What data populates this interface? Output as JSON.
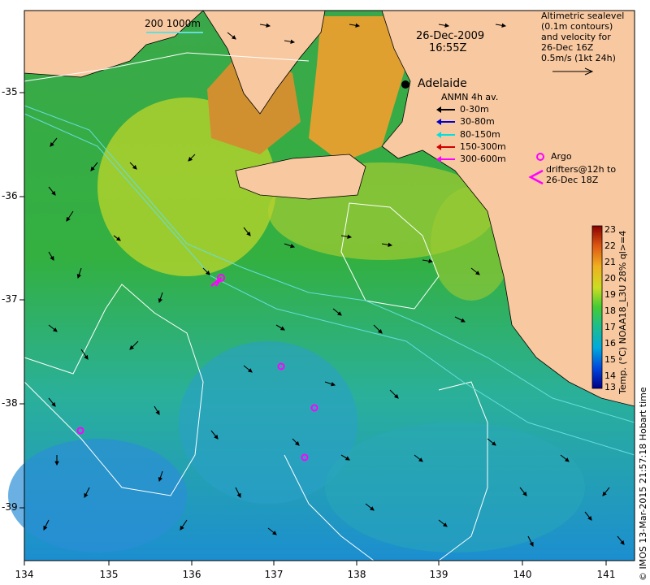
{
  "date_line": "26-Dec-2009",
  "time_line": "16:55Z",
  "scale_label": "200  1000m",
  "city_label": "Adelaide",
  "altimetry": {
    "lines": [
      "Altimetric sealevel",
      "(0.1m contours)",
      "and velocity for",
      "26-Dec 16Z",
      "0.5m/s (1kt 24h)"
    ]
  },
  "anmn": {
    "title": "ANMN 4h av.",
    "items": [
      {
        "label": "0-30m",
        "color": "#000000"
      },
      {
        "label": "30-80m",
        "color": "#0000cc"
      },
      {
        "label": "80-150m",
        "color": "#00e0e0"
      },
      {
        "label": "150-300m",
        "color": "#d00000"
      },
      {
        "label": "300-600m",
        "color": "#ff00ff"
      }
    ]
  },
  "argo": {
    "line1": "Argo",
    "line2": "drifters@12h to",
    "line3": "26-Dec 18Z",
    "color": "#ff00ff"
  },
  "colorbar": {
    "title": "Temp. (°C) NOAA18_L3U 28% ql>=4",
    "ticks": [
      "23",
      "22",
      "21",
      "20",
      "19",
      "18",
      "17",
      "16",
      "15",
      "14",
      "13"
    ]
  },
  "credit": "© IMOS 13-Mar-2015 21:57:18 Hobart time",
  "axes": {
    "x_ticks": [
      "134",
      "135",
      "136",
      "137",
      "138",
      "139",
      "140",
      "141"
    ],
    "y_ticks": [
      "-35",
      "-36",
      "-37",
      "-38",
      "-39"
    ]
  },
  "colors": {
    "land": "#f8c8a0",
    "sea_warm": "#e0a030",
    "sea_mid": "#44bb55",
    "sea_cool": "#22a0c8",
    "drifter": "#ff00ff"
  }
}
